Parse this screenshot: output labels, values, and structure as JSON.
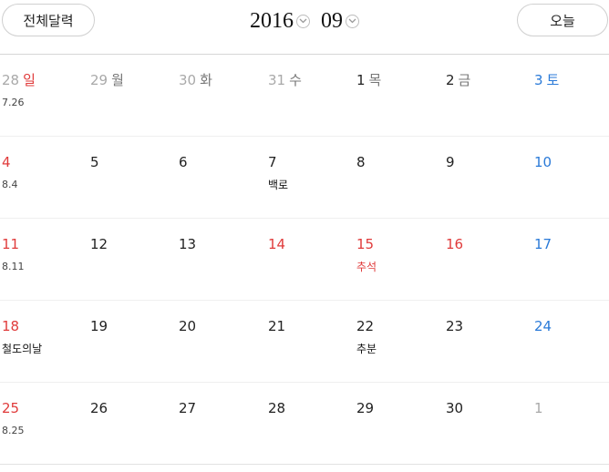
{
  "header": {
    "full_calendar_label": "전체달력",
    "today_label": "오늘",
    "year": "2016",
    "month": "09"
  },
  "weeks": [
    [
      {
        "day": "28",
        "weekday": "일",
        "lunar": "7.26",
        "holiday": "",
        "tone": "gray",
        "wdtone": "red"
      },
      {
        "day": "29",
        "weekday": "월",
        "lunar": "",
        "holiday": "",
        "tone": "gray",
        "wdtone": "gray"
      },
      {
        "day": "30",
        "weekday": "화",
        "lunar": "",
        "holiday": "",
        "tone": "gray",
        "wdtone": "gray"
      },
      {
        "day": "31",
        "weekday": "수",
        "lunar": "",
        "holiday": "",
        "tone": "gray",
        "wdtone": "gray"
      },
      {
        "day": "1",
        "weekday": "목",
        "lunar": "",
        "holiday": "",
        "tone": "black",
        "wdtone": "gray"
      },
      {
        "day": "2",
        "weekday": "금",
        "lunar": "",
        "holiday": "",
        "tone": "black",
        "wdtone": "gray"
      },
      {
        "day": "3",
        "weekday": "토",
        "lunar": "",
        "holiday": "",
        "tone": "blue",
        "wdtone": "blue"
      }
    ],
    [
      {
        "day": "4",
        "weekday": "",
        "lunar": "8.4",
        "holiday": "",
        "tone": "red"
      },
      {
        "day": "5",
        "weekday": "",
        "lunar": "",
        "holiday": "",
        "tone": "black"
      },
      {
        "day": "6",
        "weekday": "",
        "lunar": "",
        "holiday": "",
        "tone": "black"
      },
      {
        "day": "7",
        "weekday": "",
        "lunar": "",
        "holiday": "백로",
        "tone": "black"
      },
      {
        "day": "8",
        "weekday": "",
        "lunar": "",
        "holiday": "",
        "tone": "black"
      },
      {
        "day": "9",
        "weekday": "",
        "lunar": "",
        "holiday": "",
        "tone": "black"
      },
      {
        "day": "10",
        "weekday": "",
        "lunar": "",
        "holiday": "",
        "tone": "blue"
      }
    ],
    [
      {
        "day": "11",
        "weekday": "",
        "lunar": "8.11",
        "holiday": "",
        "tone": "red"
      },
      {
        "day": "12",
        "weekday": "",
        "lunar": "",
        "holiday": "",
        "tone": "black"
      },
      {
        "day": "13",
        "weekday": "",
        "lunar": "",
        "holiday": "",
        "tone": "black"
      },
      {
        "day": "14",
        "weekday": "",
        "lunar": "",
        "holiday": "",
        "tone": "red"
      },
      {
        "day": "15",
        "weekday": "",
        "lunar": "",
        "holiday": "추석",
        "tone": "red",
        "holtone": "red"
      },
      {
        "day": "16",
        "weekday": "",
        "lunar": "",
        "holiday": "",
        "tone": "red"
      },
      {
        "day": "17",
        "weekday": "",
        "lunar": "",
        "holiday": "",
        "tone": "blue"
      }
    ],
    [
      {
        "day": "18",
        "weekday": "",
        "lunar": "",
        "holiday": "철도의날",
        "tone": "red"
      },
      {
        "day": "19",
        "weekday": "",
        "lunar": "",
        "holiday": "",
        "tone": "black"
      },
      {
        "day": "20",
        "weekday": "",
        "lunar": "",
        "holiday": "",
        "tone": "black"
      },
      {
        "day": "21",
        "weekday": "",
        "lunar": "",
        "holiday": "",
        "tone": "black"
      },
      {
        "day": "22",
        "weekday": "",
        "lunar": "",
        "holiday": "추분",
        "tone": "black"
      },
      {
        "day": "23",
        "weekday": "",
        "lunar": "",
        "holiday": "",
        "tone": "black"
      },
      {
        "day": "24",
        "weekday": "",
        "lunar": "",
        "holiday": "",
        "tone": "blue"
      }
    ],
    [
      {
        "day": "25",
        "weekday": "",
        "lunar": "8.25",
        "holiday": "",
        "tone": "red"
      },
      {
        "day": "26",
        "weekday": "",
        "lunar": "",
        "holiday": "",
        "tone": "black"
      },
      {
        "day": "27",
        "weekday": "",
        "lunar": "",
        "holiday": "",
        "tone": "black"
      },
      {
        "day": "28",
        "weekday": "",
        "lunar": "",
        "holiday": "",
        "tone": "black"
      },
      {
        "day": "29",
        "weekday": "",
        "lunar": "",
        "holiday": "",
        "tone": "black"
      },
      {
        "day": "30",
        "weekday": "",
        "lunar": "",
        "holiday": "",
        "tone": "black"
      },
      {
        "day": "1",
        "weekday": "",
        "lunar": "",
        "holiday": "",
        "tone": "gray"
      }
    ]
  ]
}
